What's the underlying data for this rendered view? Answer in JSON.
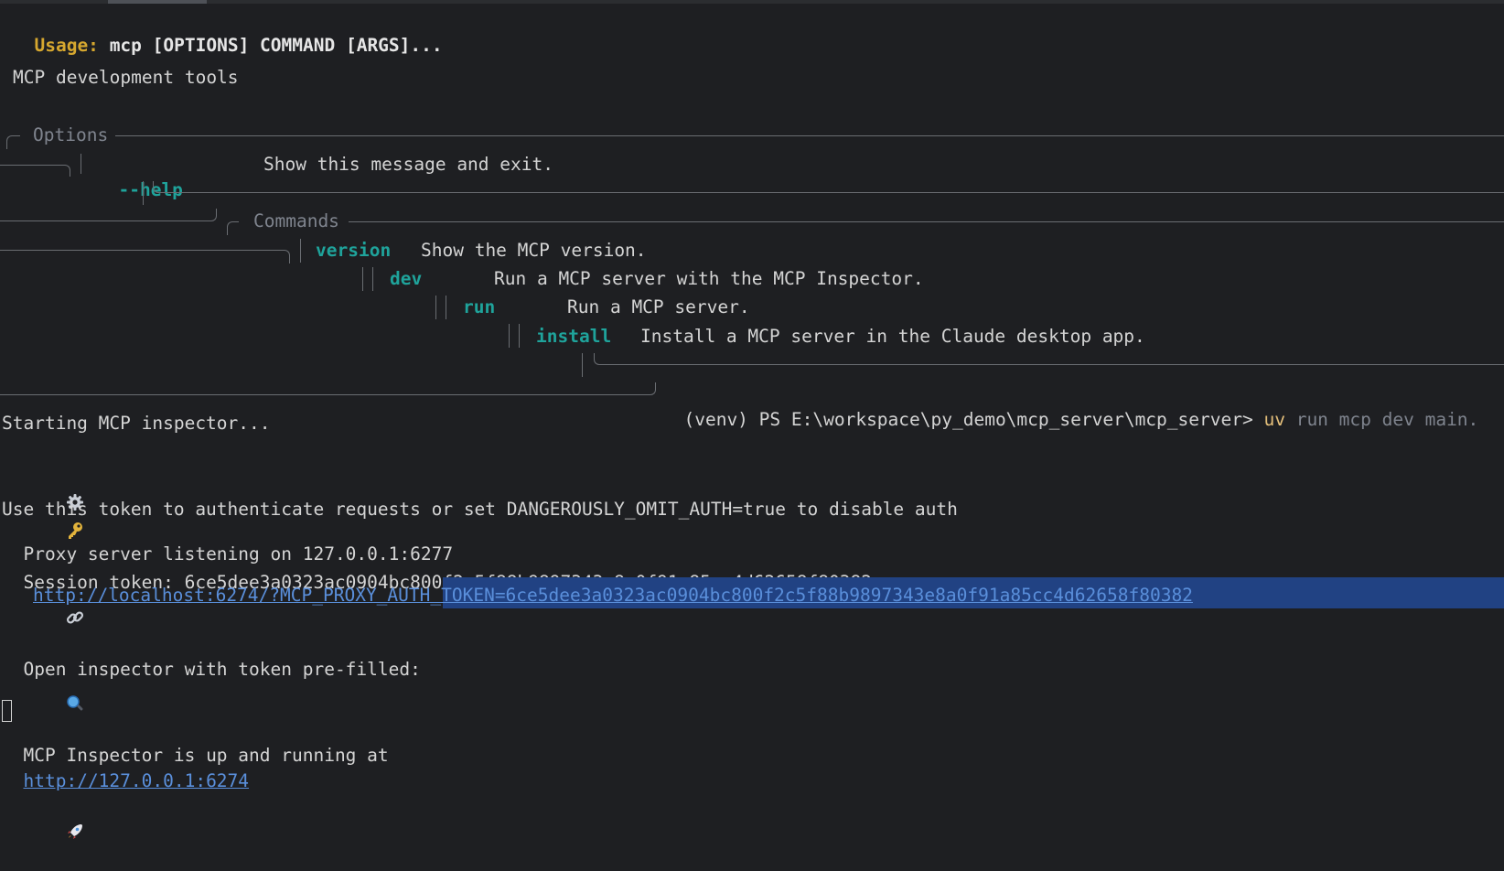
{
  "usage": {
    "label": "Usage:",
    "command": "mcp [OPTIONS] COMMAND [ARGS]..."
  },
  "description": "MCP development tools",
  "options_panel": {
    "title": "Options",
    "items": [
      {
        "flag": "--help",
        "desc": "Show this message and exit."
      }
    ]
  },
  "commands_panel": {
    "title": "Commands",
    "items": [
      {
        "name": "version",
        "desc": "Show the MCP version."
      },
      {
        "name": "dev",
        "desc": "Run a MCP server with the MCP Inspector."
      },
      {
        "name": "run",
        "desc": "Run a MCP server."
      },
      {
        "name": "install",
        "desc": "Install a MCP server in the Claude desktop app."
      }
    ]
  },
  "prompt": {
    "text": "(venv) PS E:\\workspace\\py_demo\\mcp_server\\mcp_server>",
    "cmd": "uv",
    "args": "run mcp dev main."
  },
  "output": {
    "starting": "Starting MCP inspector...",
    "proxy": "Proxy server listening on 127.0.0.1:6277",
    "session": "Session token: 6ce5dee3a0323ac0904bc800f2c5f88b9897343e8a0f91a85cc4d62658f80382",
    "use_token": "Use this token to authenticate requests or set DANGEROUSLY_OMIT_AUTH=true to disable auth",
    "open_inspector": "Open inspector with token pre-filled:",
    "inspector_url": "http://localhost:6274/?MCP_PROXY_AUTH_TOKEN=6ce5dee3a0323ac0904bc800f2c5f88b9897343e8a0f91a85cc4d62658f80382",
    "running_prefix": "MCP Inspector is up and running at",
    "running_url": "http://127.0.0.1:6274"
  },
  "icons": {
    "gear": "gear-icon",
    "key": "key-icon",
    "link": "link-icon",
    "magnifier": "magnifier-icon",
    "rocket": "rocket-icon"
  },
  "colors": {
    "background": "#1e1f22",
    "usage": "#d6a72f",
    "accent": "#1fa39b",
    "link": "#5a8fdb",
    "selection": "#214283"
  }
}
